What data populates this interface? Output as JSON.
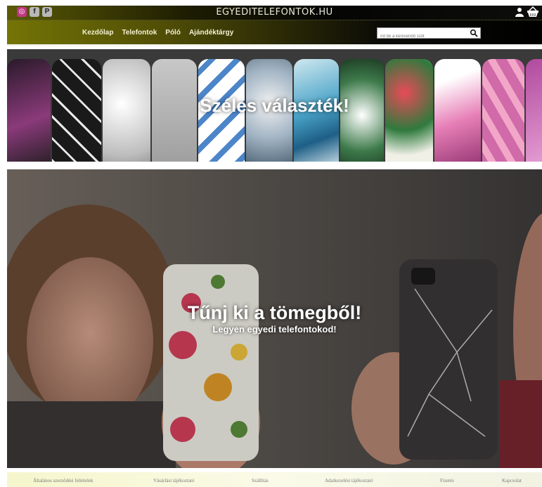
{
  "brand": {
    "name": "EGYEDITELEFONTOK.HU"
  },
  "social": [
    {
      "icon": "instagram-icon",
      "glyph": "◎"
    },
    {
      "icon": "facebook-icon",
      "glyph": "f"
    },
    {
      "icon": "pinterest-icon",
      "glyph": "P"
    }
  ],
  "header_icons": [
    "user-icon",
    "cart-icon"
  ],
  "nav": {
    "items": [
      "Kezdőlap",
      "Telefontok",
      "Póló",
      "Ajándéktárgy"
    ]
  },
  "search": {
    "placeholder": "Írd be a keresendő szót",
    "value": ""
  },
  "banner1": {
    "title": "Széles választék!"
  },
  "banner2": {
    "title": "Tűnj ki a tömegből!",
    "subtitle": "Legyen egyedi telefontokod!"
  },
  "footer": {
    "links": [
      "Általános szerződési feltételek",
      "Vásárlási tájékoztató",
      "Szállítás",
      "Adatkezelési tájékoztató",
      "Fizetés",
      "Kapcsolat"
    ]
  },
  "colors": {
    "header_dark": "#050504",
    "header_olive": "#747406",
    "footer_bg": "#f6f6cc",
    "instagram": "#c13584"
  }
}
